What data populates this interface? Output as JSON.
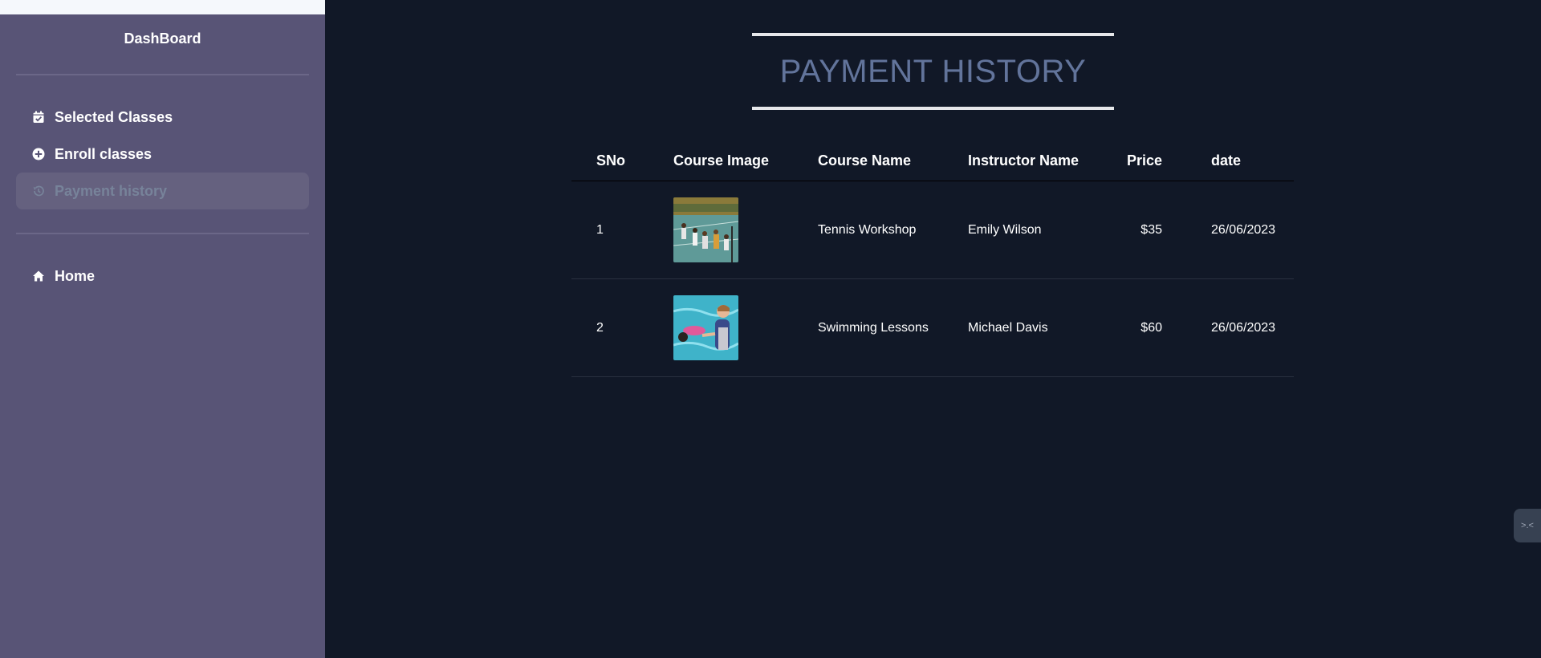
{
  "sidebar": {
    "title": "DashBoard",
    "items": [
      {
        "label": "Selected Classes",
        "icon": "calendar-check-icon"
      },
      {
        "label": "Enroll classes",
        "icon": "plus-circle-icon"
      },
      {
        "label": "Payment history",
        "icon": "history-icon",
        "active": true
      }
    ],
    "secondary_items": [
      {
        "label": "Home",
        "icon": "home-icon"
      }
    ]
  },
  "main": {
    "title": "PAYMENT HISTORY",
    "table": {
      "headers": [
        "SNo",
        "Course Image",
        "Course Name",
        "Instructor Name",
        "Price",
        "date"
      ],
      "rows": [
        {
          "sno": "1",
          "image": "tennis-class-photo",
          "course": "Tennis Workshop",
          "instructor": "Emily Wilson",
          "price": "$35",
          "date": "26/06/2023"
        },
        {
          "sno": "2",
          "image": "swimming-lesson-photo",
          "course": "Swimming Lessons",
          "instructor": "Michael Davis",
          "price": "$60",
          "date": "26/06/2023"
        }
      ]
    }
  },
  "widget": {
    "label": ">.<"
  },
  "colors": {
    "sidebar_bg": "#585476",
    "main_bg": "#111827",
    "title_color": "#62749b",
    "active_item_bg": "#65617f",
    "active_item_text": "#77839a"
  }
}
